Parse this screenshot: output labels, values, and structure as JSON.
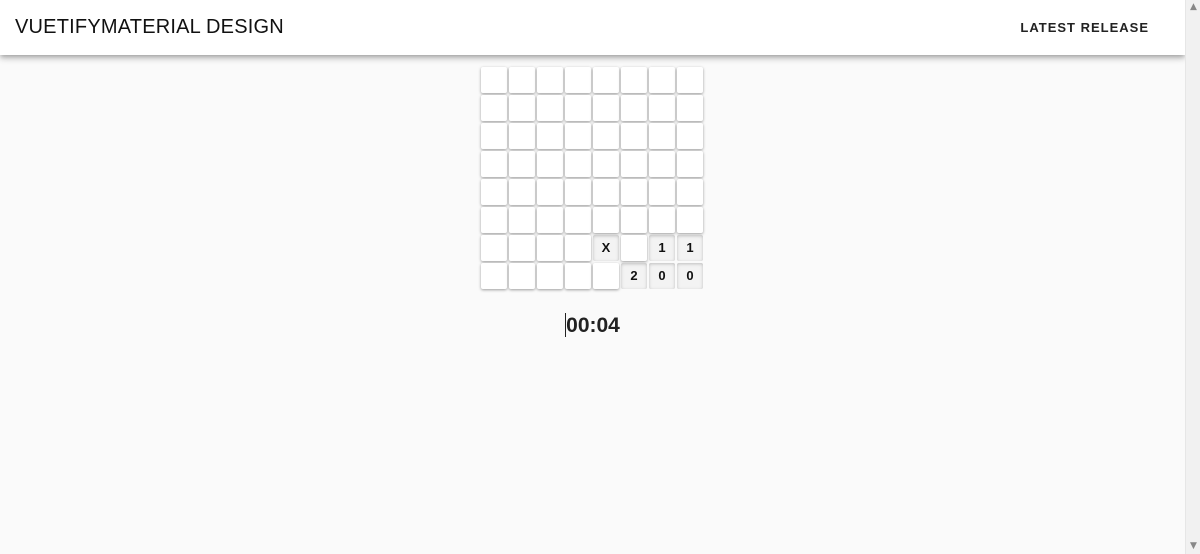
{
  "app_bar": {
    "brand_bold": "VUETIFY",
    "brand_light": "MATERIAL DESIGN",
    "release_label": "LATEST RELEASE"
  },
  "game": {
    "rows": 8,
    "cols": 8,
    "cells": [
      [
        "",
        "",
        "",
        "",
        "",
        "",
        "",
        ""
      ],
      [
        "",
        "",
        "",
        "",
        "",
        "",
        "",
        ""
      ],
      [
        "",
        "",
        "",
        "",
        "",
        "",
        "",
        ""
      ],
      [
        "",
        "",
        "",
        "",
        "",
        "",
        "",
        ""
      ],
      [
        "",
        "",
        "",
        "",
        "",
        "",
        "",
        ""
      ],
      [
        "",
        "",
        "",
        "",
        "",
        "",
        "",
        ""
      ],
      [
        "",
        "",
        "",
        "",
        "X",
        "",
        "1",
        "1"
      ],
      [
        "",
        "",
        "",
        "",
        "",
        "2",
        "0",
        "0"
      ]
    ],
    "revealed": [
      [
        6,
        4
      ],
      [
        6,
        6
      ],
      [
        6,
        7
      ],
      [
        7,
        5
      ],
      [
        7,
        6
      ],
      [
        7,
        7
      ]
    ],
    "timer": "00:04"
  },
  "icons": {
    "scroll_up": "chevron-up-icon",
    "scroll_down": "chevron-down-icon"
  }
}
